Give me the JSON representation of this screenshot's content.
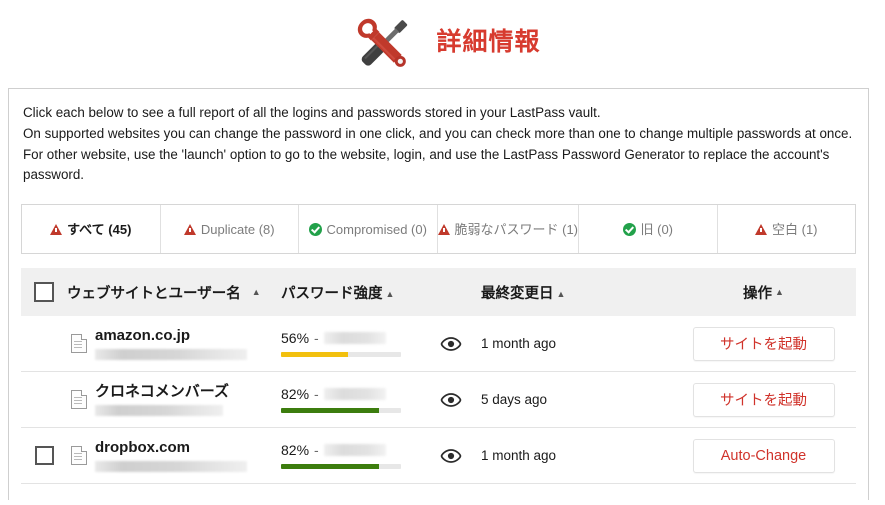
{
  "header": {
    "title": "詳細情報",
    "icon": "tools-wrench-screwdriver-icon",
    "title_color": "#d73b2f"
  },
  "description": {
    "line1": "Click each below to see a full report of all the logins and passwords stored in your LastPass vault.",
    "line2": "On supported websites you can change the password in one click, and you can check more than one to change multiple passwords at once. For other website, use the 'launch' option to go to the website, login, and use the LastPass Password Generator to replace the account's password."
  },
  "tabs": [
    {
      "label": "すべて (45)",
      "icon": "warning-triangle-icon",
      "icon_type": "warning",
      "active": true
    },
    {
      "label": "Duplicate (8)",
      "icon": "warning-triangle-icon",
      "icon_type": "warning",
      "active": false
    },
    {
      "label": "Compromised (0)",
      "icon": "check-circle-icon",
      "icon_type": "ok",
      "active": false
    },
    {
      "label": "脆弱なパスワード (1)",
      "icon": "warning-triangle-icon",
      "icon_type": "warning",
      "active": false
    },
    {
      "label": "旧 (0)",
      "icon": "check-circle-icon",
      "icon_type": "ok",
      "active": false
    },
    {
      "label": "空白 (1)",
      "icon": "warning-triangle-icon",
      "icon_type": "warning",
      "active": false
    }
  ],
  "table": {
    "headers": {
      "site": "ウェブサイトとユーザー名",
      "strength": "パスワード強度",
      "modified": "最終変更日",
      "action": "操作",
      "sort_arrow": "▲"
    },
    "rows": [
      {
        "has_checkbox": false,
        "checked": false,
        "icon": "document-icon",
        "site": "amazon.co.jp",
        "username_redacted": true,
        "strength_pct": "56%",
        "strength_value": 56,
        "strength_dash": "-",
        "strength_label_redacted": true,
        "strength_color": "#f2c00e",
        "eye_icon": "eye-icon",
        "modified": "1 month ago",
        "action_label": "サイトを起動"
      },
      {
        "has_checkbox": false,
        "checked": false,
        "icon": "document-icon",
        "site": "クロネコメンバーズ",
        "username_redacted": true,
        "strength_pct": "82%",
        "strength_value": 82,
        "strength_dash": "-",
        "strength_label_redacted": true,
        "strength_color": "#3c7d0e",
        "eye_icon": "eye-icon",
        "modified": "5 days ago",
        "action_label": "サイトを起動"
      },
      {
        "has_checkbox": true,
        "checked": false,
        "icon": "document-icon",
        "site": "dropbox.com",
        "username_redacted": true,
        "strength_pct": "82%",
        "strength_value": 82,
        "strength_dash": "-",
        "strength_label_redacted": true,
        "strength_color": "#3c7d0e",
        "eye_icon": "eye-icon",
        "modified": "1 month ago",
        "action_label": "Auto-Change"
      }
    ]
  },
  "colors": {
    "accent_red": "#d0332b",
    "warning_red": "#c0392b",
    "ok_green": "#22a14a",
    "strength_weak": "#f2c00e",
    "strength_strong": "#3c7d0e",
    "header_bg": "#f0f0f0"
  }
}
